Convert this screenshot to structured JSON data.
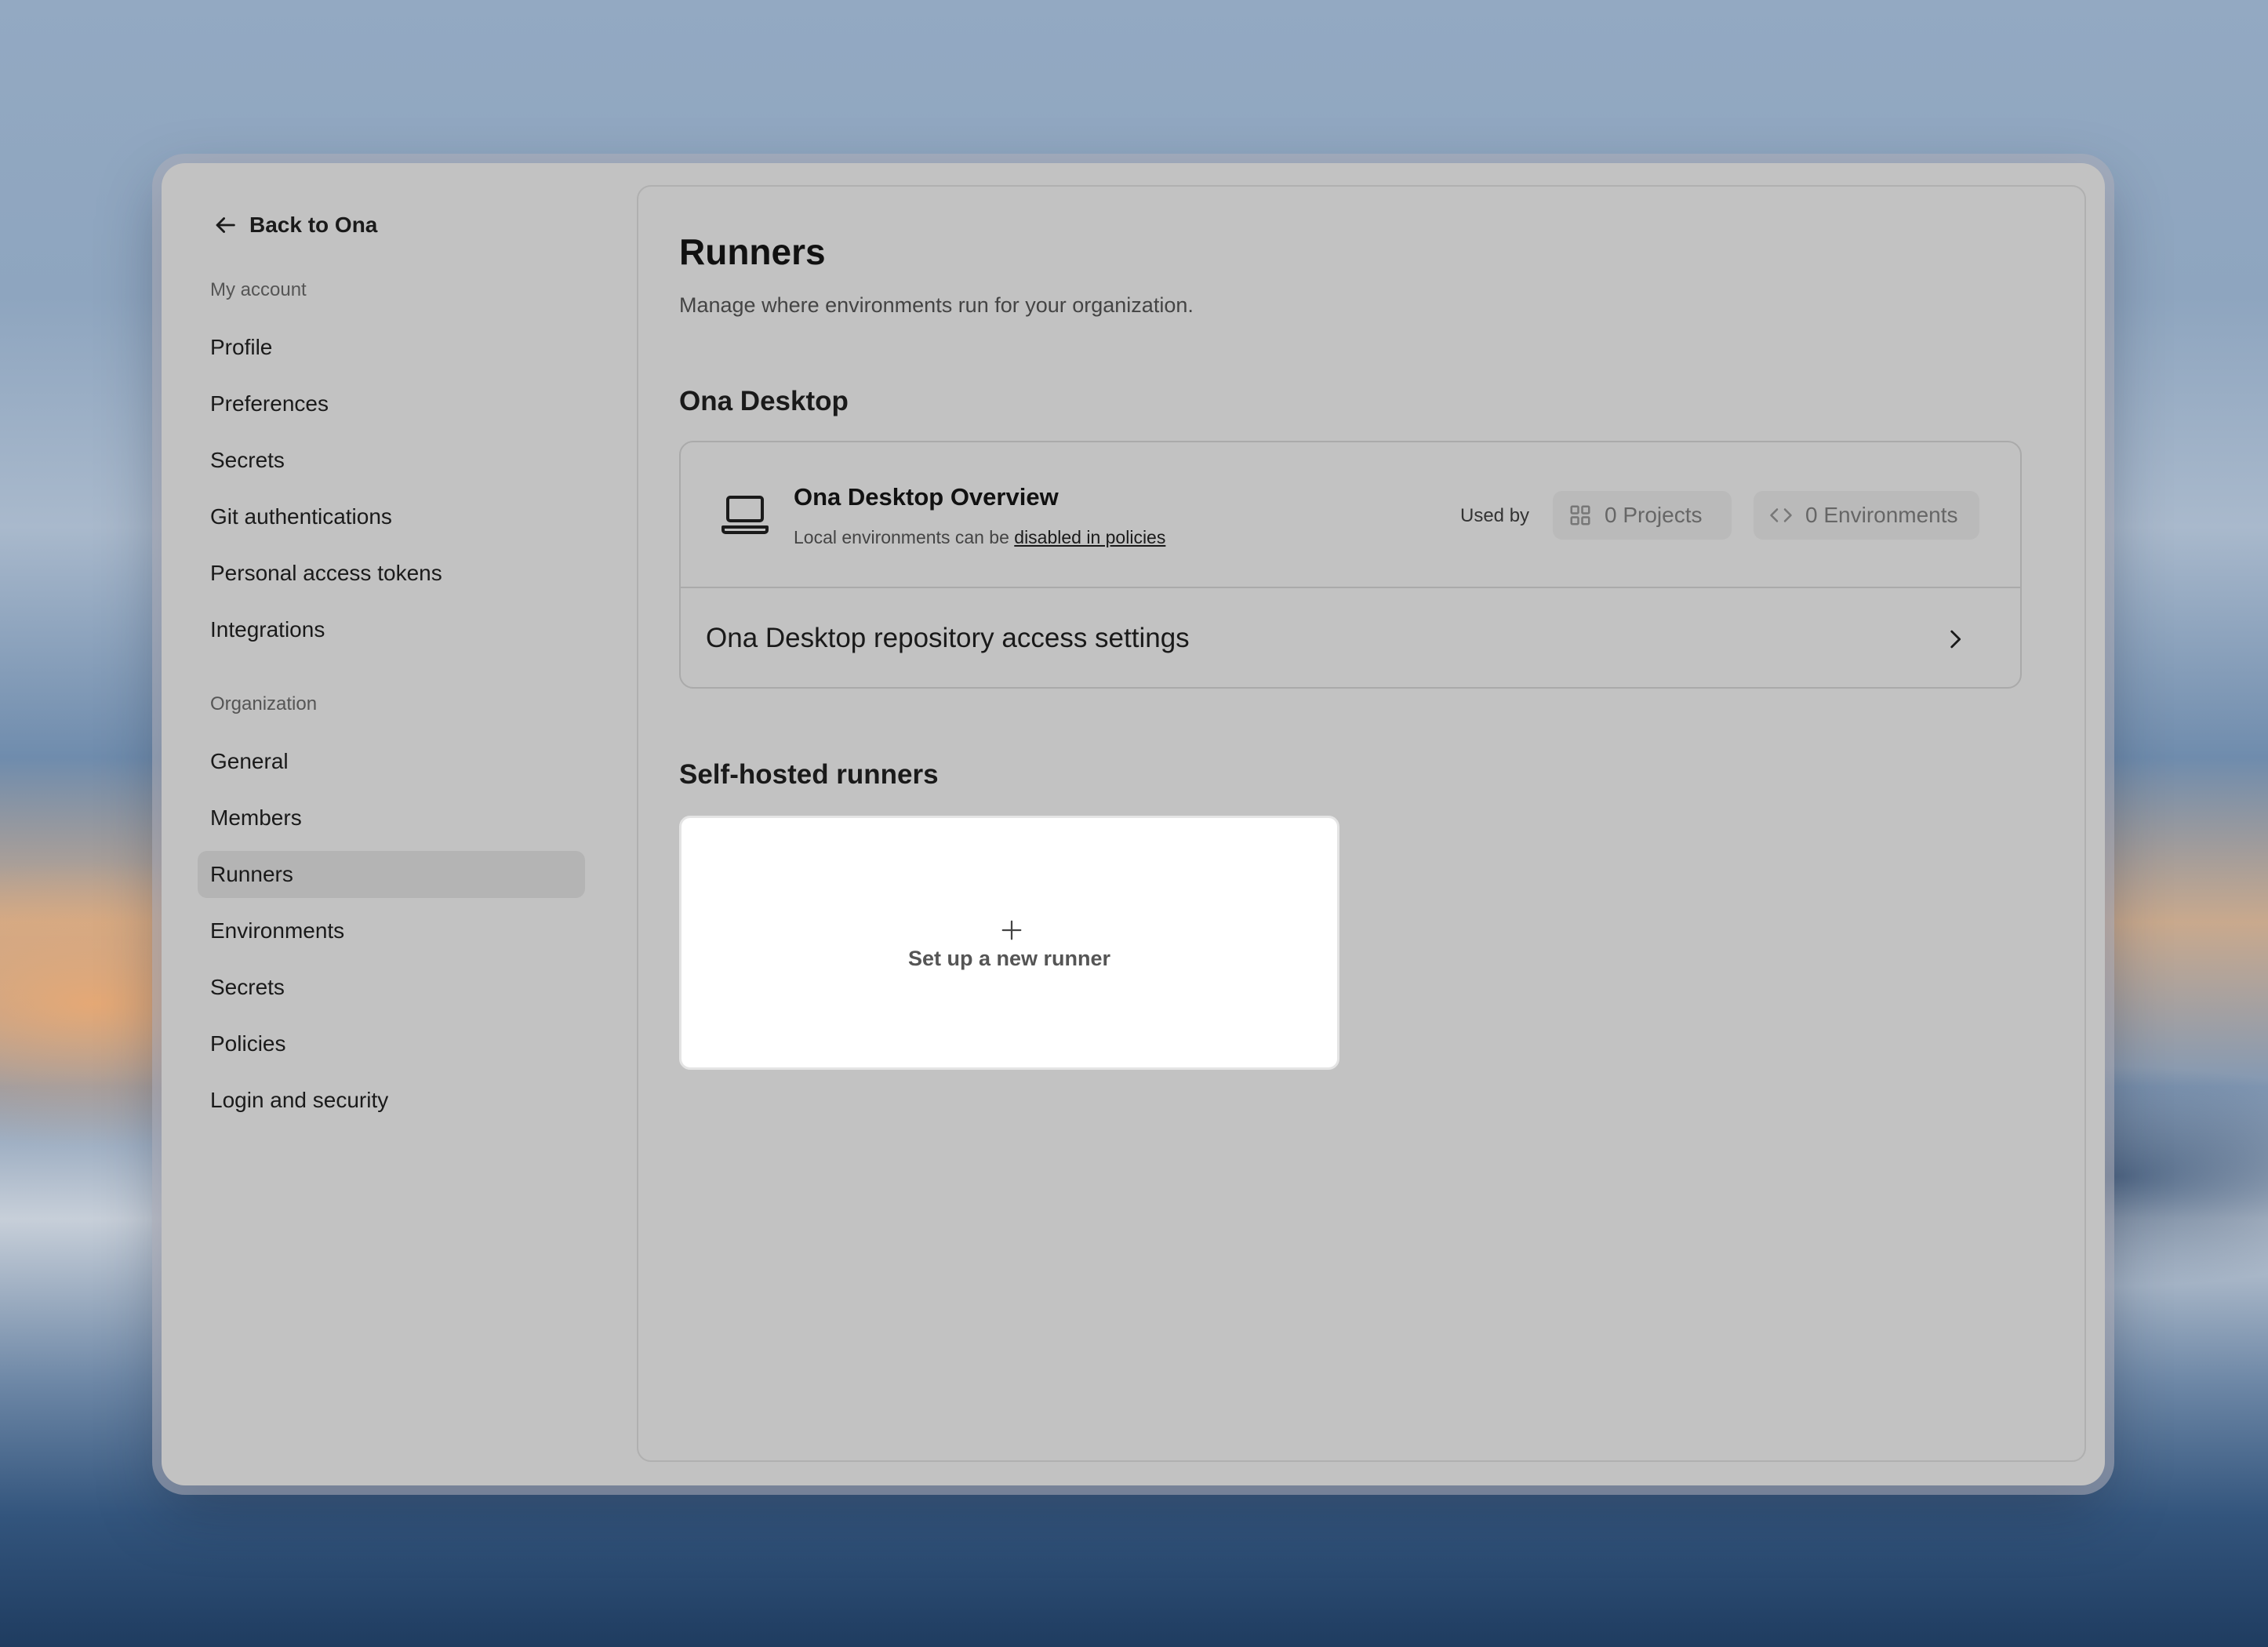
{
  "sidebar": {
    "back_label": "Back to Ona",
    "my_account_label": "My account",
    "my_account_items": [
      {
        "label": "Profile"
      },
      {
        "label": "Preferences"
      },
      {
        "label": "Secrets"
      },
      {
        "label": "Git authentications"
      },
      {
        "label": "Personal access tokens"
      },
      {
        "label": "Integrations"
      }
    ],
    "organization_label": "Organization",
    "organization_items": [
      {
        "label": "General"
      },
      {
        "label": "Members"
      },
      {
        "label": "Runners",
        "active": true
      },
      {
        "label": "Environments"
      },
      {
        "label": "Secrets"
      },
      {
        "label": "Policies"
      },
      {
        "label": "Login and security"
      }
    ]
  },
  "main": {
    "title": "Runners",
    "subtitle": "Manage where environments run for your organization.",
    "desktop_section_title": "Ona Desktop",
    "overview": {
      "icon": "laptop-icon",
      "title": "Ona Desktop Overview",
      "desc_prefix": "Local environments can be ",
      "desc_link": "disabled in policies",
      "used_by_label": "Used by",
      "projects_label": "0 Projects",
      "environments_label": "0 Environments"
    },
    "access_settings_label": "Ona Desktop repository access settings",
    "self_hosted_title": "Self-hosted runners",
    "new_runner_label": "Set up a new runner"
  }
}
